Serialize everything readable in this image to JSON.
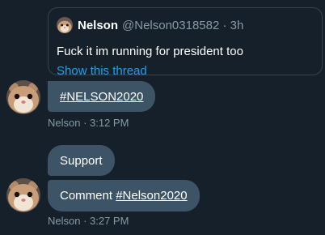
{
  "quoted_tweet": {
    "author_name": "Nelson",
    "author_meta": "@Nelson0318582 · 3h",
    "text": "Fuck it im running for president too",
    "link_label": "Show this thread"
  },
  "messages": [
    {
      "parts": [
        {
          "text": "#NELSON2020",
          "hashtag": true
        }
      ]
    },
    {
      "parts": [
        {
          "text": "Support",
          "hashtag": false
        }
      ]
    },
    {
      "parts": [
        {
          "text": "Comment ",
          "hashtag": false
        },
        {
          "text": "#Nelson2020",
          "hashtag": true
        }
      ]
    }
  ],
  "timestamps": [
    "Nelson · 3:12 PM",
    "Nelson · 3:27 PM"
  ],
  "colors": {
    "background": "#15202b",
    "bubble": "#3d5466",
    "link": "#1da1f2",
    "secondary_text": "#8899a6",
    "card_border": "#38444d"
  },
  "icons": {
    "avatar": "hamster-avatar-icon"
  }
}
